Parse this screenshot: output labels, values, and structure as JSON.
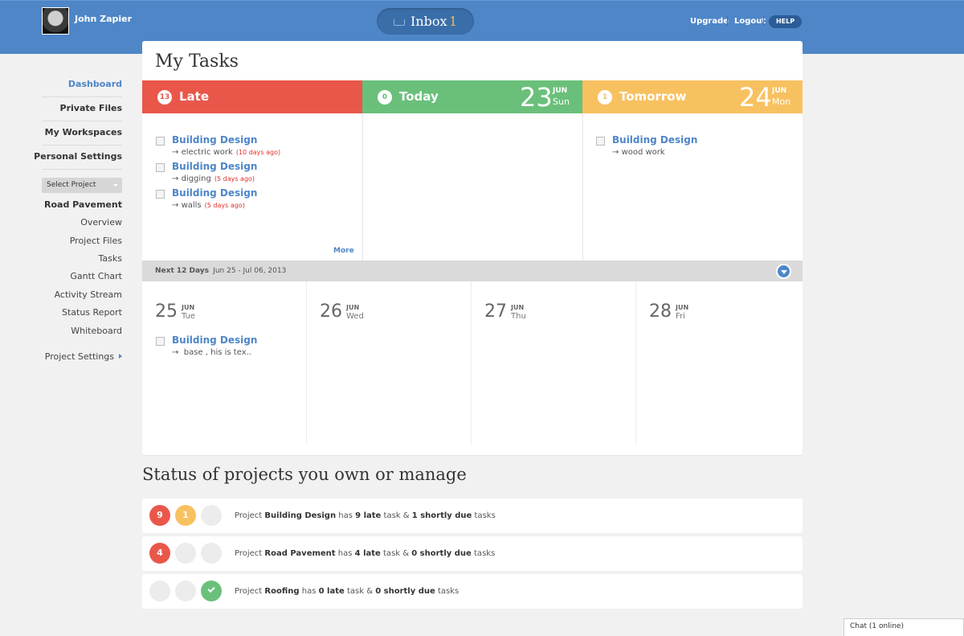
{
  "header": {
    "user_name": "John Zapier",
    "inbox_label": "Inbox",
    "inbox_count": "1",
    "upgrade_label": "Upgrade",
    "logout_label": "Logout",
    "help_label": "HELP"
  },
  "sidebar": {
    "main_items": [
      {
        "label": "Dashboard",
        "active": true
      },
      {
        "label": "Private Files",
        "active": false
      },
      {
        "label": "My Workspaces",
        "active": false
      },
      {
        "label": "Personal Settings",
        "active": false
      }
    ],
    "project_select_placeholder": "Select Project",
    "project_name": "Road Pavement",
    "project_items": [
      {
        "label": "Overview"
      },
      {
        "label": "Project Files"
      },
      {
        "label": "Tasks"
      },
      {
        "label": "Gantt Chart"
      },
      {
        "label": "Activity Stream"
      },
      {
        "label": "Status Report"
      },
      {
        "label": "Whiteboard"
      }
    ],
    "project_settings_label": "Project Settings"
  },
  "main": {
    "title": "My Tasks",
    "columns": [
      {
        "label": "Late",
        "count": "13",
        "color": "#e9574a"
      },
      {
        "label": "Today",
        "count": "0",
        "color": "#6ac07a",
        "day": "23",
        "month": "JUN",
        "weekday": "Sun"
      },
      {
        "label": "Tomorrow",
        "count": "1",
        "color": "#f8c160",
        "day": "24",
        "month": "JUN",
        "weekday": "Mon"
      }
    ],
    "late_tasks": [
      {
        "name": "Building Design",
        "sub": "electric work",
        "ago": "(10 days ago)"
      },
      {
        "name": "Building Design",
        "sub": "digging",
        "ago": "(5 days ago)"
      },
      {
        "name": "Building Design",
        "sub": "walls",
        "ago": "(5 days ago)"
      }
    ],
    "tomorrow_tasks": [
      {
        "name": "Building Design",
        "sub": "wood work"
      }
    ],
    "more_label": "More",
    "next_label": "Next 12 Days",
    "next_range": "Jun 25 - Jul 06, 2013",
    "next_days": [
      {
        "day": "25",
        "month": "JUN",
        "weekday": "Tue"
      },
      {
        "day": "26",
        "month": "JUN",
        "weekday": "Wed"
      },
      {
        "day": "27",
        "month": "JUN",
        "weekday": "Thu"
      },
      {
        "day": "28",
        "month": "JUN",
        "weekday": "Fri"
      }
    ],
    "next_tasks": [
      {
        "name": "Building Design",
        "sub": "base , his is tex.."
      }
    ]
  },
  "status": {
    "title": "Status of projects you own or manage",
    "rows": [
      {
        "project": "Building Design",
        "late": "9",
        "due": "1",
        "done": false,
        "late_text": "9 late",
        "due_text": "1 shortly due"
      },
      {
        "project": "Road Pavement",
        "late": "4",
        "due": "",
        "done": false,
        "late_text": "4 late",
        "due_text": "0 shortly due"
      },
      {
        "project": "Roofing",
        "late": "",
        "due": "",
        "done": true,
        "late_text": "0 late",
        "due_text": "0 shortly due"
      }
    ],
    "word_project": "Project",
    "word_has": "has",
    "word_task_and": "task &",
    "word_tasks": "tasks"
  },
  "chat": {
    "label": "Chat (1 online)"
  }
}
